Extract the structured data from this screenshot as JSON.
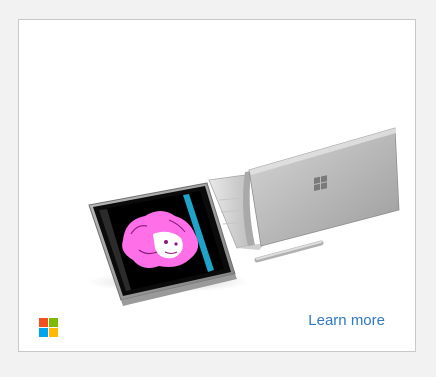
{
  "ad": {
    "brand_icon": "microsoft-windows-logo-icon",
    "cta_label": "Learn more",
    "product_image": "surface-book-laptop-and-detached-tablet",
    "colors": {
      "cta": "#2f79c2",
      "logo_red": "#f25022",
      "logo_green": "#7fba00",
      "logo_blue": "#00a4ef",
      "logo_yellow": "#ffb900",
      "tablet_screen_art": "#ff6fe8"
    }
  }
}
